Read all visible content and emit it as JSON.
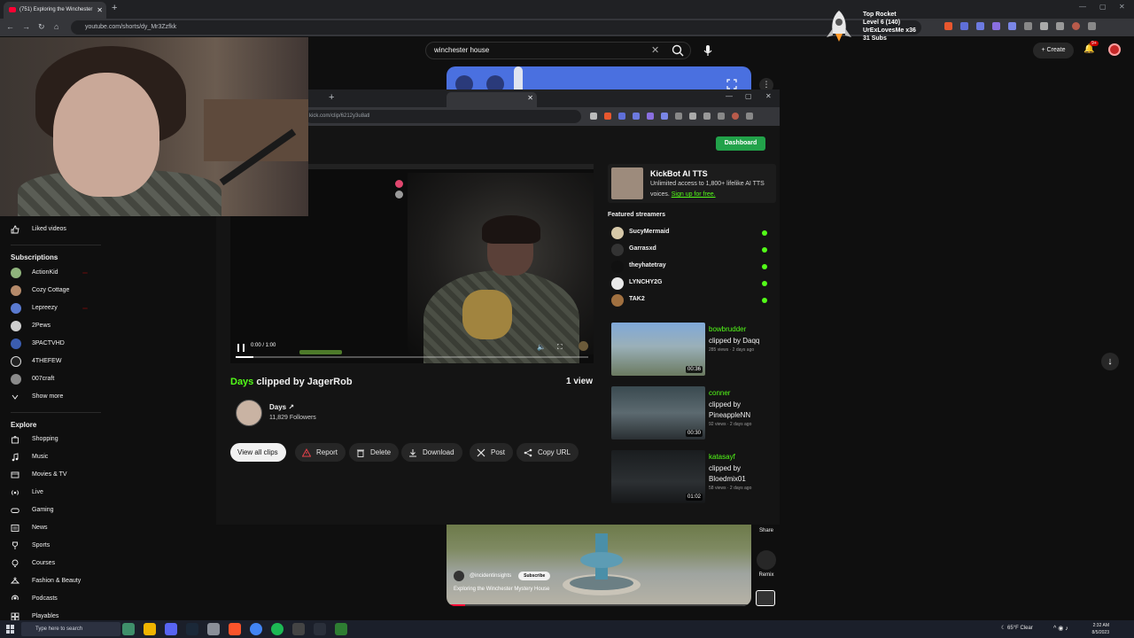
{
  "browser": {
    "tab_title": "(751) Exploring the Winchester",
    "url": "youtube.com/shorts/dy_Mr3Zzfkk"
  },
  "overlay": {
    "title": "Top Rocket",
    "level": "Level 6 (140)",
    "user": "UrExLovesMe x36",
    "subs": "31 Subs"
  },
  "youtube": {
    "search_value": "winchester house",
    "create_label": "Create",
    "notification_count": "9+",
    "sidebar": {
      "liked_videos": "Liked videos",
      "subscriptions_heading": "Subscriptions",
      "subscriptions": [
        "ActionKid",
        "Cozy Cottage",
        "Lepreezy",
        "2Pews",
        "3PACTVHD",
        "4THEFEW",
        "007craft"
      ],
      "show_more": "Show more",
      "explore_heading": "Explore",
      "explore_items": [
        "Shopping",
        "Music",
        "Movies & TV",
        "Live",
        "Gaming",
        "News",
        "Sports",
        "Courses",
        "Fashion & Beauty",
        "Podcasts",
        "Playables"
      ]
    },
    "short": {
      "channel": "@incidentinsights",
      "subscribe_label": "Subscribe",
      "title": "Exploring the Winchester Mystery House",
      "share_label": "Share",
      "remix_label": "Remix",
      "progress_fraction": 0.06
    }
  },
  "popup": {
    "url": "kick.com/clip/6212y3u8atl",
    "dashboard_label": "Dashboard",
    "player": {
      "time": "0:00 / 1:00",
      "progress_fraction": 0.05
    },
    "clip": {
      "title_highlight": "Days",
      "title_rest": " clipped by JagerRob",
      "views": "1 view",
      "streamer_name": "Days",
      "followers": "11,829 Followers"
    },
    "actions": [
      "View all clips",
      "Report",
      "Delete",
      "Download",
      "Post",
      "Copy URL"
    ],
    "tts": {
      "title": "KickBot AI TTS",
      "desc": "Unlimited access to 1,800+ lifelike AI TTS voices.",
      "link": "Sign up for free."
    },
    "featured_heading": "Featured streamers",
    "featured": [
      "SucyMermaid",
      "Garrasxd",
      "theyhatetray",
      "LYNCHY2G",
      "TAK2"
    ],
    "clips": [
      {
        "title": "bowbrudder",
        "by": "clipped by Daqq",
        "meta": "285 views · 2 days ago",
        "duration": "00:36"
      },
      {
        "title": "conner",
        "by": "clipped by PineappleNN",
        "meta": "92 views · 2 days ago",
        "duration": "00:30"
      },
      {
        "title": "katasayf",
        "by": "clipped by Bloedmix01",
        "meta": "58 views · 2 days ago",
        "duration": "01:02"
      }
    ]
  },
  "taskbar": {
    "search_placeholder": "Type here to search",
    "weather": "65°F  Clear",
    "time": "2:32 AM",
    "date": "8/5/2023"
  }
}
